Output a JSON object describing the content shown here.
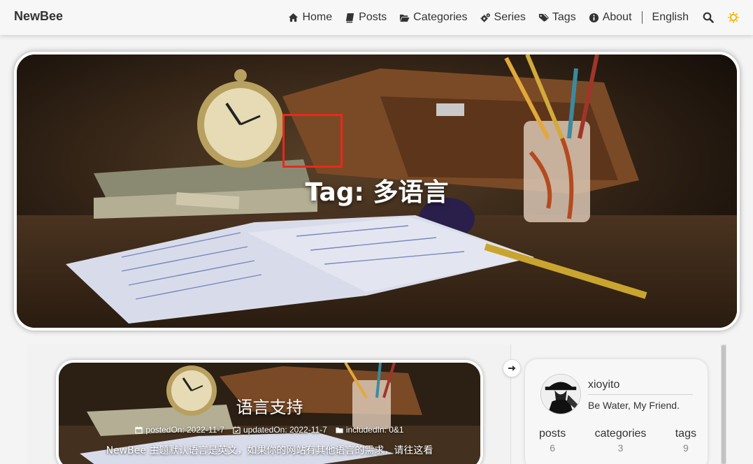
{
  "navbar": {
    "brand": "NewBee",
    "items": [
      {
        "label": "Home",
        "icon": "home-icon"
      },
      {
        "label": "Posts",
        "icon": "book-icon"
      },
      {
        "label": "Categories",
        "icon": "folder-open-icon"
      },
      {
        "label": "Series",
        "icon": "cogs-icon"
      },
      {
        "label": "Tags",
        "icon": "tags-icon"
      },
      {
        "label": "About",
        "icon": "info-circle-icon"
      }
    ],
    "language": "English",
    "search_icon": "search-icon",
    "theme_icon": "sun-icon",
    "theme_color": "#f5b50a"
  },
  "hero": {
    "title": "Tag: 多语言",
    "highlight_color": "#e8291c"
  },
  "post": {
    "title": "语言支持",
    "posted_on": "postedOn: 2022-11-7",
    "updated_on": "updatedOn: 2022-11-7",
    "included_in": "includedIn: 0&1",
    "excerpt": "NewBee 主题默认语言是英文，如果你的网站有其他语言的需求，请往这看"
  },
  "sidebar": {
    "toggle_icon": "arrow-right-icon",
    "profile": {
      "name": "xioyito",
      "bio": "Be Water, My Friend."
    },
    "stats": [
      {
        "label": "posts",
        "value": "6"
      },
      {
        "label": "categories",
        "value": "3"
      },
      {
        "label": "tags",
        "value": "9"
      }
    ]
  }
}
